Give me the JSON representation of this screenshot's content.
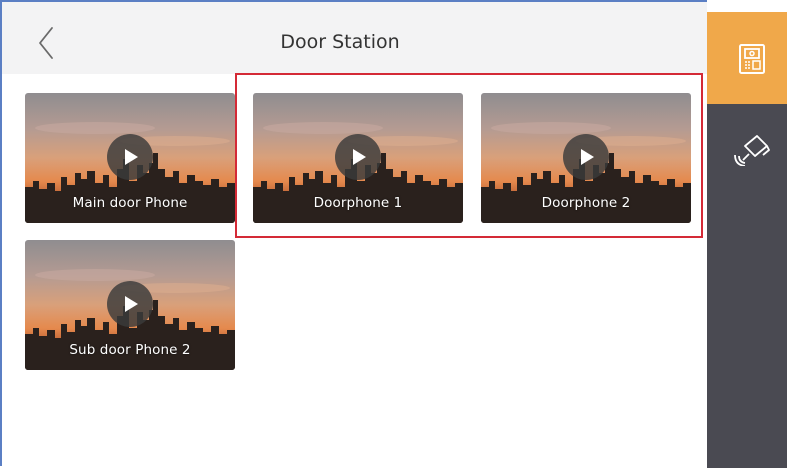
{
  "header": {
    "title": "Door Station",
    "back_icon": "chevron-left-icon"
  },
  "devices": [
    {
      "label": "Main door Phone"
    },
    {
      "label": "Doorphone 1"
    },
    {
      "label": "Doorphone 2"
    },
    {
      "label": "Sub door Phone 2"
    }
  ],
  "sidebar": {
    "items": [
      {
        "icon": "door-station-icon",
        "active": true
      },
      {
        "icon": "camera-icon",
        "active": false
      }
    ]
  },
  "colors": {
    "accent": "#f0a84a",
    "sidebar_bg": "#4a4a52",
    "highlight": "#d42a36",
    "header_bg": "#f3f3f4"
  }
}
